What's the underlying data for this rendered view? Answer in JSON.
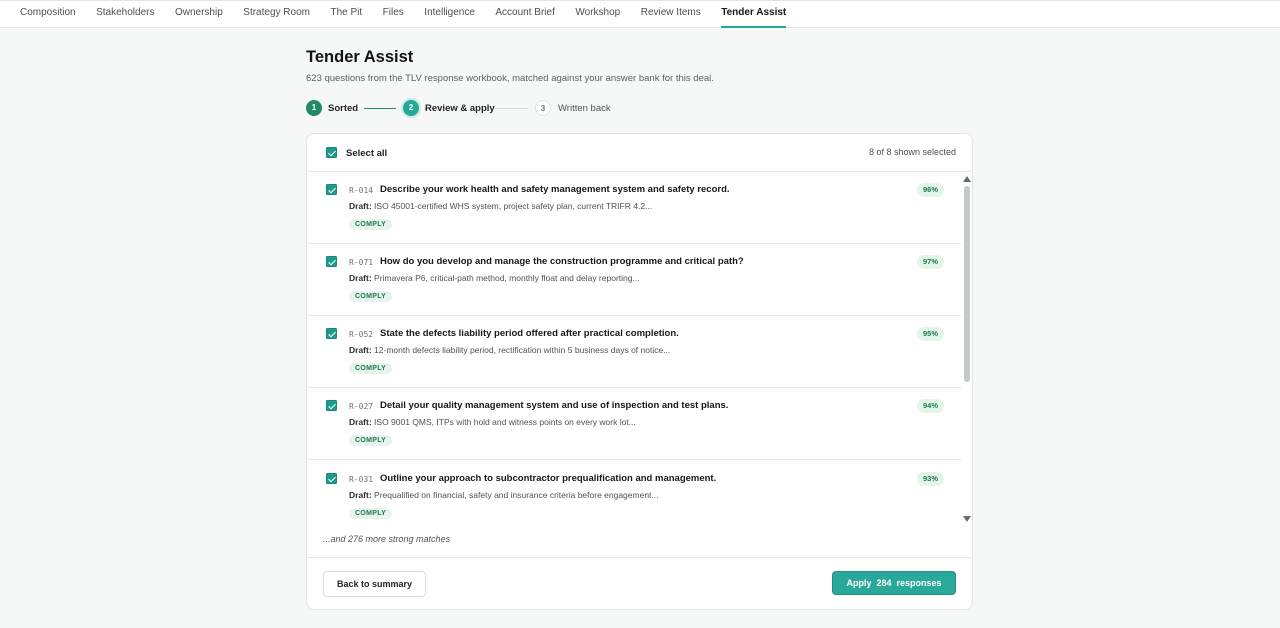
{
  "nav": {
    "tabs": [
      {
        "label": "Composition"
      },
      {
        "label": "Stakeholders"
      },
      {
        "label": "Ownership"
      },
      {
        "label": "Strategy Room"
      },
      {
        "label": "The Pit"
      },
      {
        "label": "Files"
      },
      {
        "label": "Intelligence"
      },
      {
        "label": "Account Brief"
      },
      {
        "label": "Workshop"
      },
      {
        "label": "Review Items"
      },
      {
        "label": "Tender Assist",
        "active": true
      }
    ]
  },
  "page": {
    "title": "Tender Assist",
    "subtitle": "623 questions from the TLV response workbook, matched against your answer bank for this deal."
  },
  "stepper": {
    "steps": [
      {
        "number": "1",
        "label": "Sorted",
        "state": "done"
      },
      {
        "number": "2",
        "label": "Review & apply",
        "state": "current"
      },
      {
        "number": "3",
        "label": "Written back",
        "state": "upcoming"
      }
    ]
  },
  "selection": {
    "select_all_label": "Select all",
    "select_all_checked": true,
    "shown_selected_text": "8 of 8 shown selected"
  },
  "questions": [
    {
      "code": "R-014",
      "question": "Describe your work health and safety management system and safety record.",
      "draft_label": "Draft:",
      "draft": "ISO 45001-certified WHS system, project safety plan, current TRIFR 4.2...",
      "status": "COMPLY",
      "match": "96%",
      "checked": true
    },
    {
      "code": "R-071",
      "question": "How do you develop and manage the construction programme and critical path?",
      "draft_label": "Draft:",
      "draft": "Primavera P6, critical-path method, monthly float and delay reporting...",
      "status": "COMPLY",
      "match": "97%",
      "checked": true
    },
    {
      "code": "R-052",
      "question": "State the defects liability period offered after practical completion.",
      "draft_label": "Draft:",
      "draft": "12-month defects liability period, rectification within 5 business days of notice...",
      "status": "COMPLY",
      "match": "95%",
      "checked": true
    },
    {
      "code": "R-027",
      "question": "Detail your quality management system and use of inspection and test plans.",
      "draft_label": "Draft:",
      "draft": "ISO 9001 QMS, ITPs with hold and witness points on every work lot...",
      "status": "COMPLY",
      "match": "94%",
      "checked": true
    },
    {
      "code": "R-031",
      "question": "Outline your approach to subcontractor prequalification and management.",
      "draft_label": "Draft:",
      "draft": "Prequalified on financial, safety and insurance criteria before engagement...",
      "status": "COMPLY",
      "match": "93%",
      "checked": true
    }
  ],
  "more_text": "...and 276 more strong matches",
  "footer": {
    "back_label": "Back to summary",
    "apply_label": "Apply  284  responses"
  },
  "colors": {
    "accent": "#2aa89b",
    "step_done": "#1f8a63",
    "badge_bg": "#e7f4ec",
    "badge_text": "#1f7a4f"
  }
}
